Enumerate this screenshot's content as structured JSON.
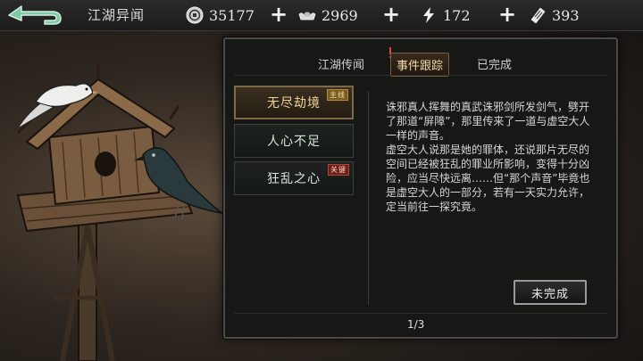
{
  "header": {
    "title": "江湖异闻",
    "currencies": [
      {
        "icon": "coin-icon",
        "value": "35177"
      },
      {
        "icon": "silver-ingot-icon",
        "value": "2969"
      },
      {
        "icon": "lightning-icon",
        "value": "172"
      },
      {
        "icon": "ticket-icon",
        "value": "393"
      }
    ],
    "plus": "+"
  },
  "tabs": [
    {
      "label": "江湖传闻"
    },
    {
      "label": "事件跟踪"
    },
    {
      "label": "已完成"
    }
  ],
  "events": [
    {
      "label": "无尽劫境",
      "badge": "主线"
    },
    {
      "label": "人心不足",
      "badge": ""
    },
    {
      "label": "狂乱之心",
      "badge": "关键"
    }
  ],
  "description": "诛邪真人挥舞的真武诛邪剑所发剑气，劈开了那道“屏障”，那里传来了一道与虚空大人一样的声音。\n虚空大人说那是她的罪体，还说那片无尽的空间已经被狂乱的罪业所影响，变得十分凶险，应当尽快远离……但“那个声音”毕竟也是虚空大人的一部分，若有一天实力允许，定当前往一探究竟。",
  "status_label": "未完成",
  "pager": "1/3",
  "colors": {
    "accent": "#f0d39c",
    "panel": "#171716"
  }
}
